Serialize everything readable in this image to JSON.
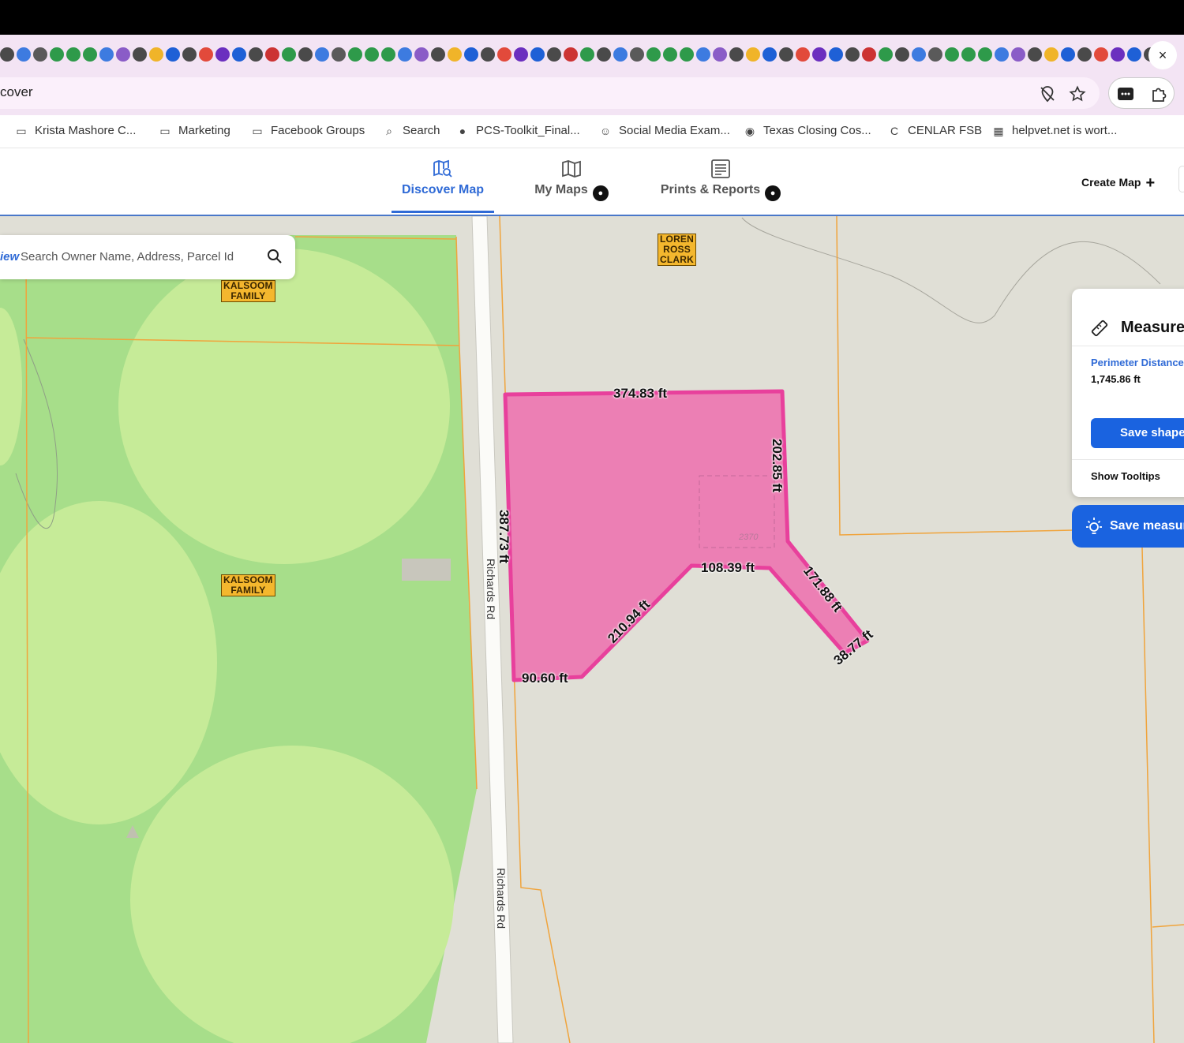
{
  "browser": {
    "close_tab_icon": "×",
    "url": "cover",
    "location_icon": "location-off-icon",
    "bookmark_star_icon": "star-icon"
  },
  "bookmarks": [
    {
      "label": "Krista Mashore C...",
      "icon": "folder-icon"
    },
    {
      "label": "Marketing",
      "icon": "folder-icon"
    },
    {
      "label": "Facebook Groups",
      "icon": "folder-icon"
    },
    {
      "label": "Search",
      "icon": "search-icon"
    },
    {
      "label": "PCS-Toolkit_Final...",
      "icon": "globe-icon"
    },
    {
      "label": "Social Media Exam...",
      "icon": "person-icon"
    },
    {
      "label": "Texas Closing Cos...",
      "icon": "chart-icon"
    },
    {
      "label": "CENLAR FSB",
      "icon": "c-logo-icon"
    },
    {
      "label": "helpvet.net is wort...",
      "icon": "grid-icon"
    }
  ],
  "app_nav": {
    "tabs": [
      {
        "label": "Discover Map",
        "active": true,
        "locked": false
      },
      {
        "label": "My Maps",
        "active": false,
        "locked": true
      },
      {
        "label": "Prints & Reports",
        "active": false,
        "locked": true
      }
    ],
    "create_map": "Create Map",
    "accent": "#2f6ad6"
  },
  "search": {
    "prefix": "iew",
    "placeholder": "Search Owner Name, Address, Parcel Id"
  },
  "map": {
    "owner_labels": [
      {
        "lines": [
          "LOREN",
          "ROSS",
          "CLARK"
        ]
      },
      {
        "lines": [
          "KALSOOM",
          "FAMILY"
        ]
      },
      {
        "lines": [
          "KALSOOM",
          "FAMILY"
        ]
      }
    ],
    "road_name": "Richards Rd",
    "parcel_number": "2370",
    "shape_color": "#e8409c",
    "segment_labels": [
      "374.83 ft",
      "202.85 ft",
      "387.73 ft",
      "108.39 ft",
      "171.88 ft",
      "210.94 ft",
      "38.77 ft",
      "90.60 ft"
    ]
  },
  "measure_panel": {
    "title": "Measure",
    "perimeter_label": "Perimeter Distance",
    "perimeter_value": "1,745.86 ft",
    "save_shape": "Save shape",
    "show_tooltips": "Show Tooltips"
  },
  "save_measurement": "Save measur"
}
